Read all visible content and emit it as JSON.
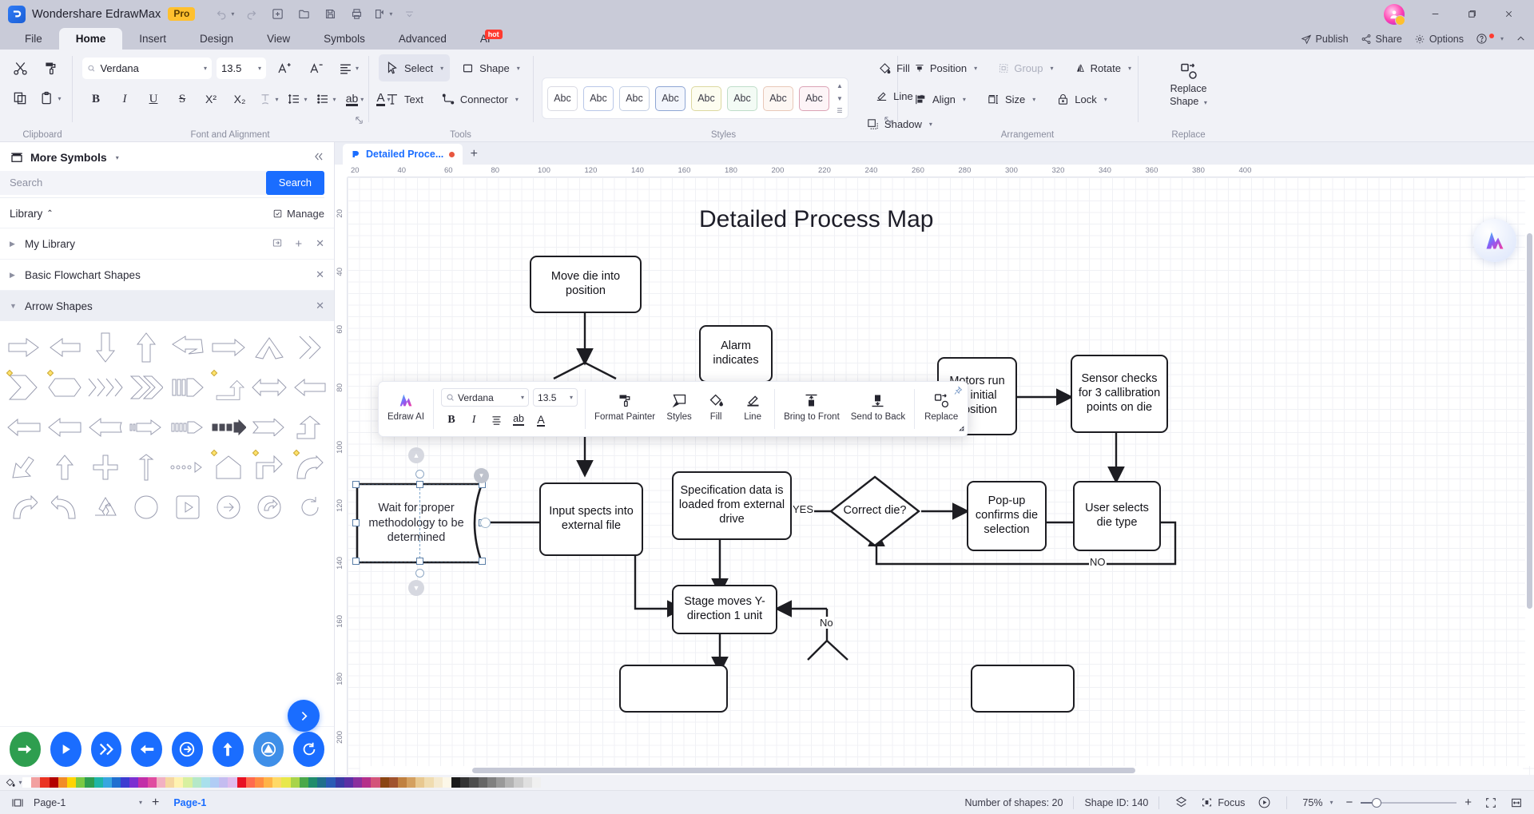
{
  "titlebar": {
    "app_name": "Wondershare EdrawMax",
    "pro_badge": "Pro",
    "quick_actions": [
      "undo-icon",
      "redo-icon",
      "new-icon",
      "open-icon",
      "save-icon",
      "print-icon",
      "export-icon",
      "more-icon"
    ],
    "window_buttons": [
      "minimize-icon",
      "restore-icon",
      "close-icon"
    ]
  },
  "menubar": {
    "items": [
      {
        "label": "File",
        "active": false
      },
      {
        "label": "Home",
        "active": true
      },
      {
        "label": "Insert",
        "active": false
      },
      {
        "label": "Design",
        "active": false
      },
      {
        "label": "View",
        "active": false
      },
      {
        "label": "Symbols",
        "active": false
      },
      {
        "label": "Advanced",
        "active": false
      },
      {
        "label": "AI",
        "active": false,
        "badge": "hot"
      }
    ],
    "right_items": [
      {
        "label": "Publish",
        "icon": "publish-icon"
      },
      {
        "label": "Share",
        "icon": "share-icon"
      },
      {
        "label": "Options",
        "icon": "gear-icon"
      },
      {
        "label": "",
        "icon": "help-icon"
      },
      {
        "label": "",
        "icon": "chevron-up-icon"
      }
    ]
  },
  "ribbon": {
    "groups": [
      {
        "name": "Clipboard",
        "label": "Clipboard"
      },
      {
        "name": "Font and Alignment",
        "label": "Font and Alignment"
      },
      {
        "name": "Tools",
        "label": "Tools"
      },
      {
        "name": "Styles",
        "label": "Styles"
      },
      {
        "name": "Arrangement",
        "label": "Arrangement"
      },
      {
        "name": "Replace",
        "label": "Replace"
      }
    ],
    "clipboard": {
      "cut": "cut-icon",
      "format_painter": "format-painter-icon",
      "copy": "copy-icon",
      "paste": "paste-icon"
    },
    "font": {
      "family_value": "Verdana",
      "family_placeholder": "Verdana",
      "size_value": "13.5",
      "increase_label": "A+",
      "decrease_label": "A-",
      "bold": "B",
      "italic": "I",
      "underline": "U",
      "strike": "S",
      "superscript": "X²",
      "subscript": "X₂"
    },
    "tools": {
      "select": "Select",
      "shape": "Shape",
      "text": "Text",
      "connector": "Connector"
    },
    "styles": {
      "swatch_label": "Abc",
      "swatch_count": 8,
      "fill": "Fill",
      "line": "Line",
      "shadow": "Shadow"
    },
    "arrangement": {
      "position": "Position",
      "group": "Group",
      "rotate": "Rotate",
      "align": "Align",
      "size": "Size",
      "lock": "Lock"
    },
    "replace": {
      "label_line1": "Replace",
      "label_line2": "Shape"
    }
  },
  "left_panel": {
    "title": "More Symbols",
    "search_placeholder": "Search",
    "search_value": "",
    "search_button": "Search",
    "library_label": "Library",
    "manage_label": "Manage",
    "trees": [
      {
        "label": "My Library",
        "expanded": false,
        "selected": false
      },
      {
        "label": "Basic Flowchart Shapes",
        "expanded": false,
        "selected": false
      },
      {
        "label": "Arrow Shapes",
        "expanded": true,
        "selected": true
      }
    ]
  },
  "canvas": {
    "document_tab": "Detailed Proce...",
    "document_modified": true,
    "add_tab": "+",
    "title": "Detailed Process Map",
    "ruler_h": [
      "20",
      "40",
      "60",
      "80",
      "100",
      "120",
      "140",
      "160",
      "180",
      "200",
      "220",
      "240",
      "260",
      "280",
      "300",
      "320",
      "340",
      "360",
      "380",
      "400"
    ],
    "ruler_v": [
      "20",
      "40",
      "60",
      "80",
      "100",
      "120",
      "140",
      "160",
      "180",
      "200"
    ],
    "selected_shape_text": "Wait for proper methodology to be determined",
    "nodes": [
      {
        "id": "move-die",
        "text": "Move die into position"
      },
      {
        "id": "alarm",
        "text": "Alarm indicates"
      },
      {
        "id": "motors-run",
        "text": "Motors run to initial position"
      },
      {
        "id": "sensor-checks",
        "text": "Sensor checks for 3 callibration points on die"
      },
      {
        "id": "input-specs",
        "text": "Input spects into external file"
      },
      {
        "id": "spec-data",
        "text": "Specification data is loaded from external drive"
      },
      {
        "id": "correct-die",
        "text": "Correct die?"
      },
      {
        "id": "popup-confirms",
        "text": "Pop-up confirms die selection"
      },
      {
        "id": "user-selects",
        "text": "User selects die type"
      },
      {
        "id": "stage-moves",
        "text": "Stage moves Y-direction 1 unit"
      }
    ],
    "edge_labels": [
      {
        "id": "yes-correct-die",
        "text": "YES"
      },
      {
        "id": "no-correct-die",
        "text": "NO"
      },
      {
        "id": "no-stage",
        "text": "No"
      }
    ]
  },
  "minibar": {
    "edraw_ai": "Edraw AI",
    "font_family": "Verdana",
    "font_size": "13.5",
    "bold": "B",
    "italic": "I",
    "align": "align-icon",
    "highlight": "ab",
    "fontcolor": "A",
    "items": [
      {
        "label": "Format Painter",
        "icon": "format-painter-icon"
      },
      {
        "label": "Styles",
        "icon": "styles-icon"
      },
      {
        "label": "Fill",
        "icon": "fill-icon"
      },
      {
        "label": "Line",
        "icon": "line-icon"
      },
      {
        "label": "Bring to Front",
        "icon": "bring-to-front-icon"
      },
      {
        "label": "Send to Back",
        "icon": "send-to-back-icon"
      },
      {
        "label": "Replace",
        "icon": "replace-shape-icon"
      }
    ]
  },
  "statusbar": {
    "page_selector": "Page-1",
    "add_page": "+",
    "page_tab": "Page-1",
    "shape_count": "Number of shapes: 20",
    "shape_id": "Shape ID: 140",
    "focus": "Focus",
    "zoom_level": "75%",
    "zoom_out": "−",
    "zoom_in": "+",
    "fit_page": "fit-page-icon",
    "fit_width": "fit-width-icon"
  },
  "colors": {
    "accent": "#1a6dff",
    "title_bar": "#c9cbd8",
    "ribbon_bg": "#f1f2f7",
    "node_border": "#1d1d22",
    "modified_dot": "#e8563f",
    "pro_badge": "#ffc02e",
    "palette": [
      "#ffffff",
      "#f2a0a0",
      "#ea3323",
      "#b30000",
      "#f28c28",
      "#ffd400",
      "#7ac943",
      "#2e9e4f",
      "#1fb5a6",
      "#37a6e0",
      "#1f6fd0",
      "#3b3bd1",
      "#7b2fd1",
      "#c22ea8",
      "#e04ca0",
      "#f2b0c2",
      "#f5d6a0",
      "#fff2b0",
      "#d8f0a0",
      "#b5e8c8",
      "#a8e0ec",
      "#b0ccf5",
      "#c4bcf0",
      "#e0bcec",
      "#e81123",
      "#ff6a4d",
      "#ff8c42",
      "#ffb347",
      "#ffd966",
      "#e8e84a",
      "#a8d44a",
      "#4aa84a",
      "#1f8c6c",
      "#1f6f8c",
      "#2a5bb5",
      "#3a3aa5",
      "#5b2fa5",
      "#8a2f9e",
      "#b52f8a",
      "#d4547a",
      "#8b4513",
      "#a0522d",
      "#c08040",
      "#d4a060",
      "#e8c890",
      "#f0dcb0",
      "#f5ead0",
      "#fcf7e8",
      "#1a1a1a",
      "#333333",
      "#4d4d4d",
      "#666666",
      "#808080",
      "#999999",
      "#b3b3b3",
      "#cccccc",
      "#e0e0e0",
      "#f0f0f0"
    ]
  }
}
